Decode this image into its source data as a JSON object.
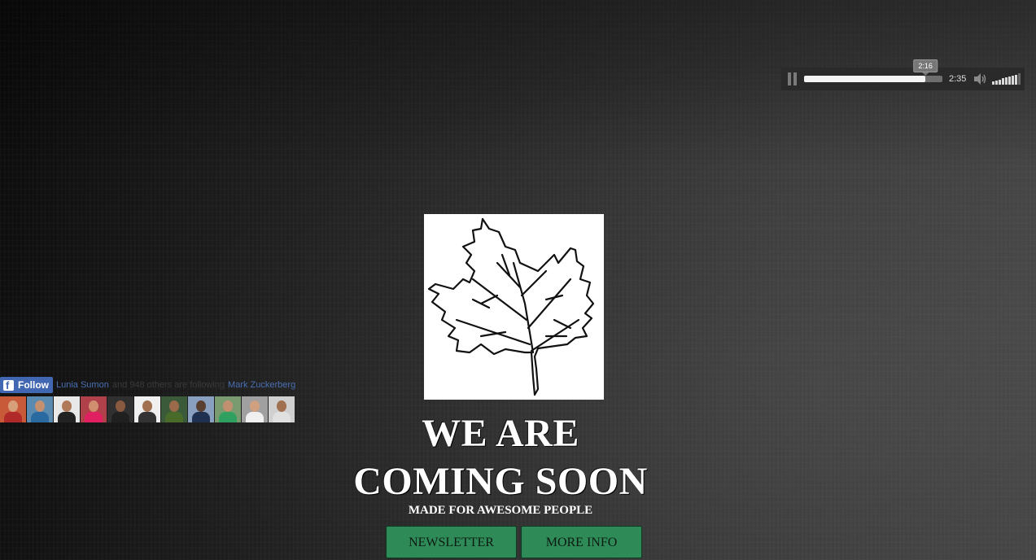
{
  "player": {
    "current_time": "2:16",
    "total_time": "2:35",
    "progress": 0.877,
    "volume_level": 0.8,
    "pause_icon": "pause-icon",
    "volume_icon": "speaker-icon"
  },
  "logo": {
    "icon": "maple-leaf-sketch"
  },
  "hero": {
    "line1": "WE ARE",
    "line2": "COMING SOON",
    "tagline": "MADE FOR AWESOME PEOPLE"
  },
  "buttons": {
    "newsletter": "NEWSLETTER",
    "more_info": "MORE INFO"
  },
  "facebook": {
    "follow_label": "Follow",
    "friend_name": "Lunia Sumon",
    "middle_text": "and 948 others are following",
    "page_name": "Mark Zuckerberg",
    "faces": [
      {
        "bg": "#c85a3a",
        "skin": "#d8a07a",
        "shirt": "#b02a2a"
      },
      {
        "bg": "#5a8ab0",
        "skin": "#c59070",
        "shirt": "#2a6aa0"
      },
      {
        "bg": "#e8e8e8",
        "skin": "#b07a5a",
        "shirt": "#222222"
      },
      {
        "bg": "#b0404a",
        "skin": "#d09070",
        "shirt": "#e02060"
      },
      {
        "bg": "#303030",
        "skin": "#8a5a40",
        "shirt": "#202020"
      },
      {
        "bg": "#f0f0f0",
        "skin": "#a07050",
        "shirt": "#333333"
      },
      {
        "bg": "#3a5a3a",
        "skin": "#9a6a4a",
        "shirt": "#4a6a2a"
      },
      {
        "bg": "#8aa0c0",
        "skin": "#5a4030",
        "shirt": "#203050"
      },
      {
        "bg": "#7a9a70",
        "skin": "#c09070",
        "shirt": "#30a060"
      },
      {
        "bg": "#a0a0a0",
        "skin": "#d0a080",
        "shirt": "#f0f0f0"
      },
      {
        "bg": "#d0d0d0",
        "skin": "#a07050",
        "shirt": "#e0e0e0"
      }
    ]
  },
  "colors": {
    "button_green": "#2e8b57",
    "facebook_blue": "#4267b2"
  }
}
